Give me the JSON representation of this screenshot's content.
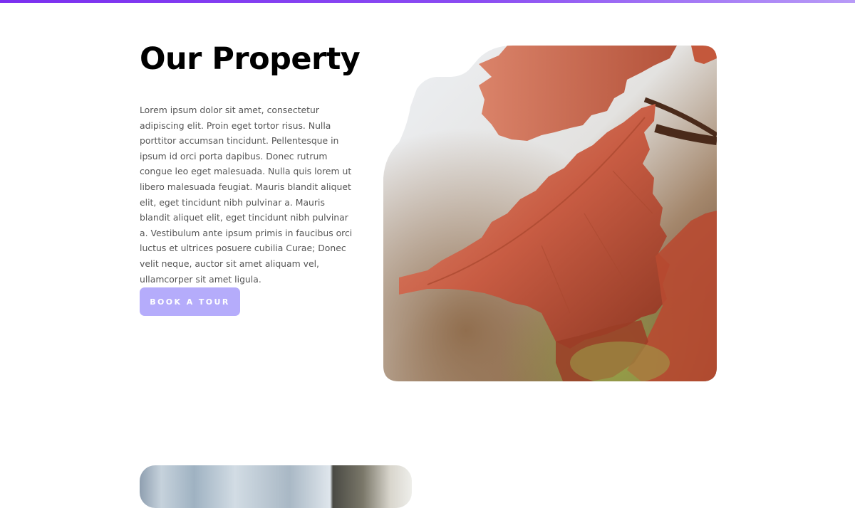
{
  "section": {
    "title": "Our Property",
    "body": "Lorem ipsum dolor sit amet, consectetur adipiscing elit. Proin eget tortor risus. Nulla porttitor accumsan tincidunt. Pellentesque in ipsum id orci porta dapibus. Donec rutrum congue leo eget malesuada. Nulla quis lorem ut libero malesuada feugiat. Mauris blandit aliquet elit, eget tincidunt nibh pulvinar a. Mauris blandit aliquet elit, eget tincidunt nibh pulvinar a. Vestibulum ante ipsum primis in faucibus orci luctus et ultrices posuere cubilia Curae; Donec velit neque, auctor sit amet aliquam vel, ullamcorper sit amet ligula.",
    "cta_label": "BOOK A TOUR"
  },
  "colors": {
    "accent_gradient_start": "#7b2ff0",
    "accent_gradient_end": "#b89bf7",
    "button_bg": "#b5acfb",
    "button_text": "#ffffff",
    "heading": "#000000",
    "body_text": "#555555"
  },
  "images": {
    "hero": "autumn-oak-leaves-photo",
    "lower": "frosted-glass-interior-photo"
  }
}
